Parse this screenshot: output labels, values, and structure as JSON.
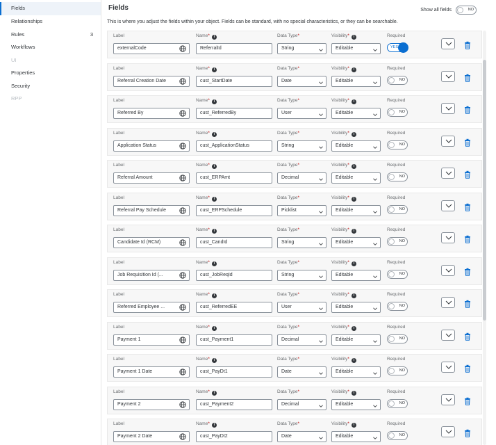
{
  "sidebar": {
    "items": [
      {
        "label": "Fields",
        "active": true,
        "disabled": false,
        "count": ""
      },
      {
        "label": "Relationships",
        "active": false,
        "disabled": false,
        "count": ""
      },
      {
        "label": "Rules",
        "active": false,
        "disabled": false,
        "count": "3"
      },
      {
        "label": "Workflows",
        "active": false,
        "disabled": false,
        "count": ""
      },
      {
        "label": "UI",
        "active": false,
        "disabled": true,
        "count": ""
      },
      {
        "label": "Properties",
        "active": false,
        "disabled": false,
        "count": ""
      },
      {
        "label": "Security",
        "active": false,
        "disabled": false,
        "count": ""
      },
      {
        "label": "RPP",
        "active": false,
        "disabled": true,
        "count": ""
      }
    ]
  },
  "header": {
    "title": "Fields",
    "show_all_label": "Show all fields",
    "show_all_value": "NO",
    "description": "This is where you adjust the fields within your object. Fields can be standard, with no special characteristics, or they can be searchable."
  },
  "columns": {
    "label": "Label",
    "name": "Name",
    "data_type": "Data Type",
    "visibility": "Visibility",
    "required": "Required",
    "required_mark": "*"
  },
  "colors": {
    "accent": "#0a6ed1",
    "required_mark": "#bb0000",
    "delete_icon": "#0a6ed1"
  },
  "fields": [
    {
      "label": "externalCode",
      "name": "ReferralId",
      "data_type": "String",
      "visibility": "Editable",
      "required": "YES",
      "required_on": true
    },
    {
      "label": "Referral Creation Date",
      "name": "cust_StartDate",
      "data_type": "Date",
      "visibility": "Editable",
      "required": "NO",
      "required_on": false
    },
    {
      "label": "Referred By",
      "name": "cust_ReferredBy",
      "data_type": "User",
      "visibility": "Editable",
      "required": "NO",
      "required_on": false
    },
    {
      "label": "Application Status",
      "name": "cust_ApplicationStatus",
      "data_type": "String",
      "visibility": "Editable",
      "required": "NO",
      "required_on": false
    },
    {
      "label": "Referral Amount",
      "name": "cust_ERPAmt",
      "data_type": "Decimal",
      "visibility": "Editable",
      "required": "NO",
      "required_on": false
    },
    {
      "label": "Referral Pay Schedule",
      "name": "cust_ERPSchedule",
      "data_type": "Picklist",
      "visibility": "Editable",
      "required": "NO",
      "required_on": false
    },
    {
      "label": "Candidate Id (RCM)",
      "name": "cust_CandId",
      "data_type": "String",
      "visibility": "Editable",
      "required": "NO",
      "required_on": false
    },
    {
      "label": "Job Requisition Id (...",
      "name": "cust_JobReqId",
      "data_type": "String",
      "visibility": "Editable",
      "required": "NO",
      "required_on": false
    },
    {
      "label": "Referred Employee ...",
      "name": "cust_ReferredEE",
      "data_type": "User",
      "visibility": "Editable",
      "required": "NO",
      "required_on": false
    },
    {
      "label": "Payment 1",
      "name": "cust_Payment1",
      "data_type": "Decimal",
      "visibility": "Editable",
      "required": "NO",
      "required_on": false
    },
    {
      "label": "Payment 1 Date",
      "name": "cust_PayDt1",
      "data_type": "Date",
      "visibility": "Editable",
      "required": "NO",
      "required_on": false
    },
    {
      "label": "Payment 2",
      "name": "cust_Payment2",
      "data_type": "Decimal",
      "visibility": "Editable",
      "required": "NO",
      "required_on": false
    },
    {
      "label": "Payment 2 Date",
      "name": "cust_PayDt2",
      "data_type": "Date",
      "visibility": "Editable",
      "required": "NO",
      "required_on": false
    }
  ],
  "icons": {
    "globe": "globe-icon",
    "chevron": "chevron-down-icon",
    "delete": "trash-icon",
    "info": "info-icon"
  }
}
